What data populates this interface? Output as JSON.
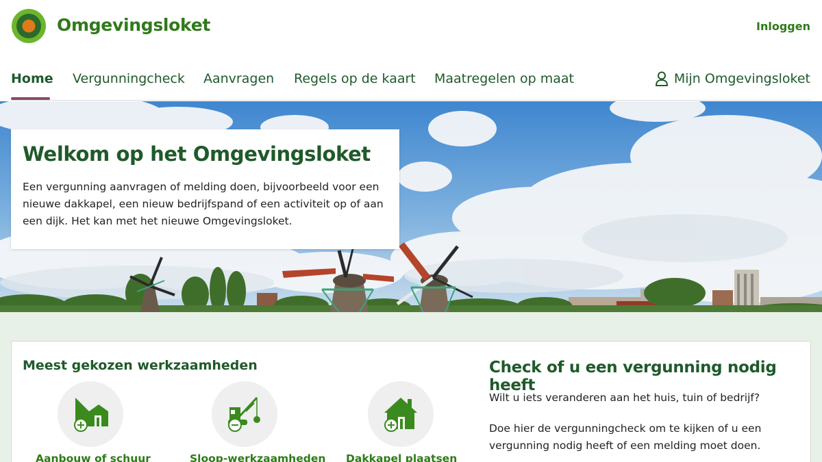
{
  "header": {
    "brand": "Omgevingsloket",
    "login_label": "Inloggen"
  },
  "nav": {
    "items": [
      {
        "label": "Home",
        "active": true
      },
      {
        "label": "Vergunningcheck",
        "active": false
      },
      {
        "label": "Aanvragen",
        "active": false
      },
      {
        "label": "Regels op de kaart",
        "active": false
      },
      {
        "label": "Maatregelen op maat",
        "active": false
      }
    ],
    "account_label": "Mijn Omgevingsloket",
    "account_icon": "user-icon"
  },
  "hero": {
    "title": "Welkom op het Omgevingsloket",
    "text": "Een vergunning aanvragen of melding doen, bijvoorbeeld voor een nieuwe dakkapel, een nieuw bedrijfspand of een activiteit op of aan een dijk. Het kan met het nieuwe Omgevingsloket."
  },
  "popular": {
    "title": "Meest gekozen werkzaamheden",
    "tiles": [
      {
        "label": "Aanbouw of schuur",
        "icon": "extension-add-icon"
      },
      {
        "label": "Sloop-werkzaamheden",
        "icon": "demolition-crane-icon"
      },
      {
        "label": "Dakkapel plaatsen",
        "icon": "house-add-icon"
      }
    ]
  },
  "check": {
    "title": "Check of u een vergunning nodig heeft",
    "question": "Wilt u iets veranderen aan het huis, tuin of bedrijf?",
    "instruction": "Doe hier de vergunningcheck om te kijken of u een vergunning nodig heeft of een melding moet doen."
  },
  "colors": {
    "brand_green": "#2f7a1a",
    "heading_green": "#1f5a2a",
    "nav_active_underline": "#8b4a66",
    "icon_green": "#3a8a1e",
    "logo_orange": "#e07b1a",
    "lower_background": "#e8f1e8"
  }
}
